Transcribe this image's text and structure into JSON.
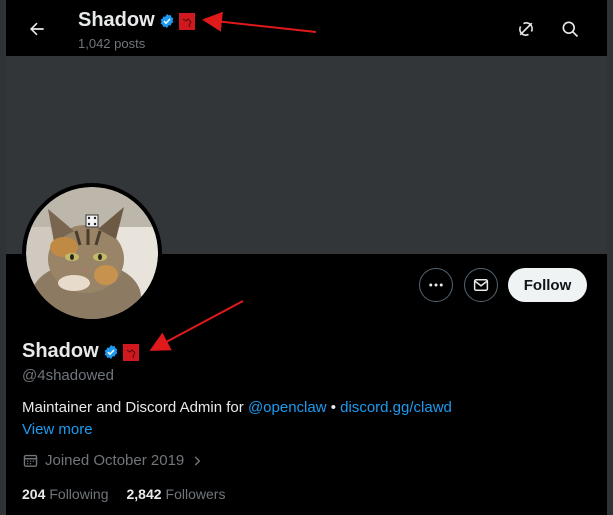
{
  "header": {
    "title": "Shadow",
    "posts_count": "1,042 posts"
  },
  "profile": {
    "name": "Shadow",
    "handle": "@4shadowed",
    "bio_prefix": "Maintainer and Discord Admin for ",
    "bio_mention": "@openclaw",
    "bio_separator": " • ",
    "bio_link": "discord.gg/clawd",
    "view_more": "View more",
    "joined": "Joined October 2019",
    "following_count": "204",
    "following_label": "Following",
    "followers_count": "2,842",
    "followers_label": "Followers"
  },
  "actions": {
    "follow_label": "Follow"
  },
  "colors": {
    "accent": "#1d9bf0",
    "verified": "#1d9bf0",
    "flag": "#d0191f",
    "annotation_arrow": "#e0191b",
    "banner": "#333639"
  },
  "icons": [
    "back-arrow-icon",
    "verified-badge-icon",
    "flag-badge-icon",
    "grok-icon",
    "search-icon",
    "more-icon",
    "message-icon",
    "calendar-icon",
    "chevron-right-icon"
  ]
}
